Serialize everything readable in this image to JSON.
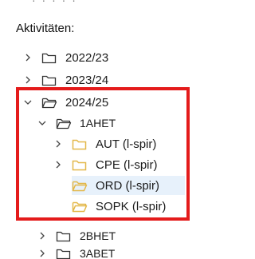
{
  "heading": "Aktivitäten:",
  "tree": {
    "year_2022": "2022/23",
    "year_2023": "2023/24",
    "year_2024": "2024/25",
    "class_1ahet": "1AHET",
    "aut": "AUT (l-spir)",
    "cpe": "CPE (l-spir)",
    "ord": "ORD (l-spir)",
    "sopk": "SOPK (l-spir)",
    "class_2bhet": "2BHET",
    "class_3abet": "3ABET"
  },
  "colors": {
    "highlight_border": "#e41b1b",
    "selected_background": "#e7f1fb",
    "folder_yellow": "#e3b84a"
  },
  "icons": {
    "collapsed": "chevron-right-icon",
    "expanded": "chevron-down-icon",
    "folder_closed": "folder-icon",
    "folder_open": "folder-open-icon"
  }
}
